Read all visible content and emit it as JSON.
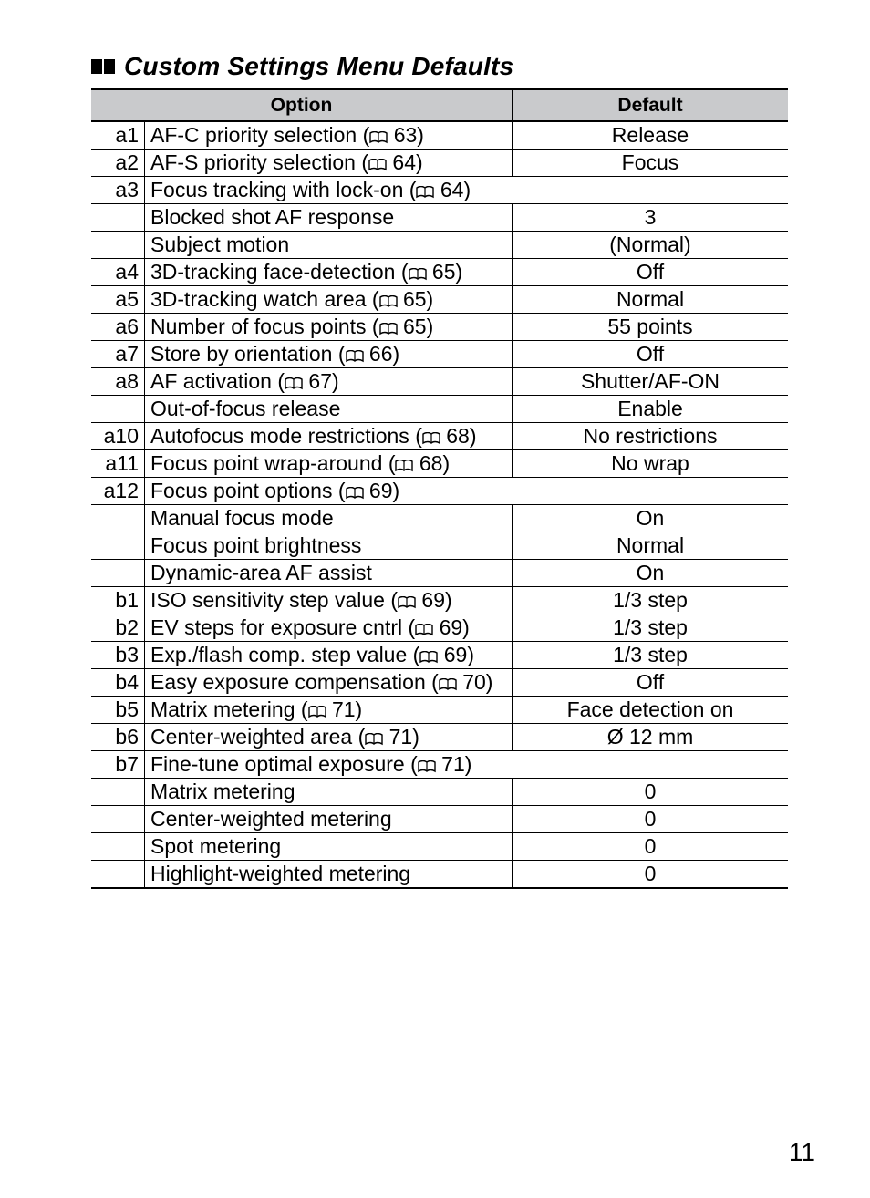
{
  "heading": "Custom Settings Menu Defaults",
  "tableHeader": {
    "option": "Option",
    "default": "Default"
  },
  "rows": [
    {
      "code": "a1",
      "name": "AF-C priority selection",
      "page": "63",
      "default": "Release"
    },
    {
      "code": "a2",
      "name": "AF-S priority selection",
      "page": "64",
      "default": "Focus"
    },
    {
      "code": "a3",
      "name": "Focus tracking with lock-on",
      "page": "64",
      "span": true
    },
    {
      "code": "",
      "sub": true,
      "name": "Blocked shot AF response",
      "default": "3"
    },
    {
      "code": "",
      "sub": true,
      "name": "Subject motion",
      "default": "(Normal)"
    },
    {
      "code": "a4",
      "name": "3D-tracking face-detection",
      "page": "65",
      "default": "Off"
    },
    {
      "code": "a5",
      "name": "3D-tracking watch area",
      "page": "65",
      "default": "Normal"
    },
    {
      "code": "a6",
      "name": "Number of focus points",
      "page": "65",
      "default": "55 points"
    },
    {
      "code": "a7",
      "name": "Store by orientation",
      "page": "66",
      "default": "Off"
    },
    {
      "code": "a8",
      "name": "AF activation",
      "page": "67",
      "default": "Shutter/AF-ON"
    },
    {
      "code": "",
      "sub": true,
      "name": "Out-of-focus release",
      "default": "Enable"
    },
    {
      "code": "a10",
      "name": "Autofocus mode restrictions",
      "page": "68",
      "default": "No restrictions"
    },
    {
      "code": "a11",
      "name": "Focus point wrap-around",
      "page": "68",
      "default": "No wrap"
    },
    {
      "code": "a12",
      "name": "Focus point options",
      "page": "69",
      "span": true
    },
    {
      "code": "",
      "sub": true,
      "name": "Manual focus mode",
      "default": "On"
    },
    {
      "code": "",
      "sub": true,
      "name": "Focus point brightness",
      "default": "Normal"
    },
    {
      "code": "",
      "sub": true,
      "name": "Dynamic-area AF assist",
      "default": "On"
    },
    {
      "code": "b1",
      "name": "ISO sensitivity step value",
      "page": "69",
      "default": "1/3 step"
    },
    {
      "code": "b2",
      "name": "EV steps for exposure cntrl",
      "page": "69",
      "default": "1/3 step"
    },
    {
      "code": "b3",
      "name": "Exp./flash comp. step value",
      "page": "69",
      "default": "1/3 step"
    },
    {
      "code": "b4",
      "name": "Easy exposure compensation",
      "page": "70",
      "default": "Off"
    },
    {
      "code": "b5",
      "name": "Matrix metering",
      "page": "71",
      "default": "Face detection on"
    },
    {
      "code": "b6",
      "name": "Center-weighted area",
      "page": "71",
      "default": "Ø 12 mm"
    },
    {
      "code": "b7",
      "name": "Fine-tune optimal exposure",
      "page": "71",
      "span": true
    },
    {
      "code": "",
      "sub": true,
      "name": "Matrix metering",
      "default": "0"
    },
    {
      "code": "",
      "sub": true,
      "name": "Center-weighted metering",
      "default": "0"
    },
    {
      "code": "",
      "sub": true,
      "name": "Spot metering",
      "default": "0"
    },
    {
      "code": "",
      "sub": true,
      "name": "Highlight-weighted metering",
      "default": "0",
      "last": true
    }
  ],
  "pageNumber": "11"
}
